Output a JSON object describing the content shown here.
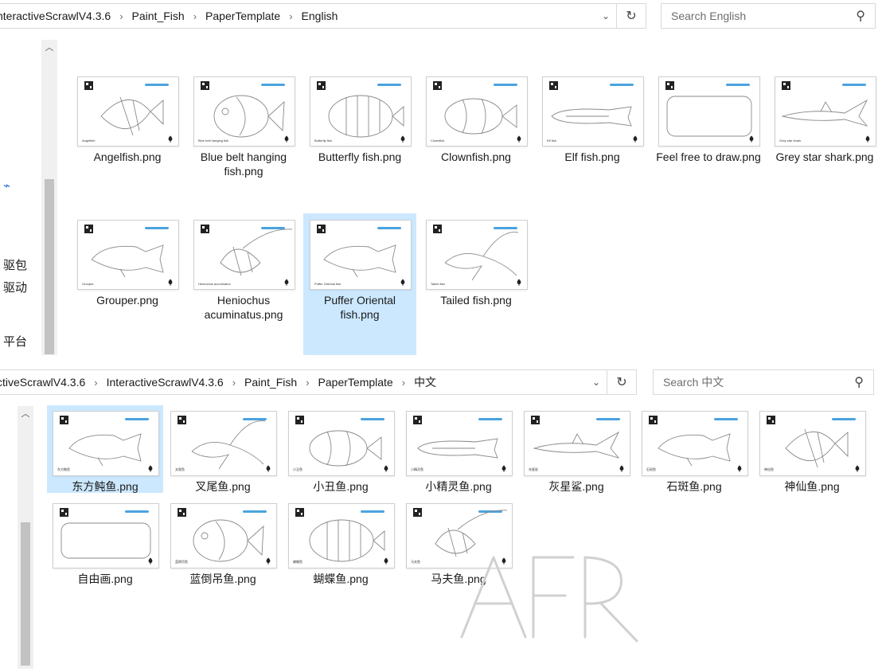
{
  "top_window": {
    "breadcrumb": [
      "nteractiveScrawlV4.3.6",
      "Paint_Fish",
      "PaperTemplate",
      "English"
    ],
    "search_placeholder": "Search English",
    "nav_labels": [
      "⌁",
      "驱包",
      "驱动",
      "平台"
    ],
    "files": [
      {
        "name": "Angelfish.png",
        "thumb_label": "Angelfish",
        "shape": "angel",
        "selected": false
      },
      {
        "name": "Blue belt hanging fish.png",
        "thumb_label": "Blue belt hanging fish",
        "shape": "round",
        "selected": false
      },
      {
        "name": "Butterfly fish.png",
        "thumb_label": "Butterfly fish",
        "shape": "butterfly",
        "selected": false
      },
      {
        "name": "Clownfish.png",
        "thumb_label": "Clownfish",
        "shape": "clown",
        "selected": false
      },
      {
        "name": "Elf fish.png",
        "thumb_label": "Elf fish",
        "shape": "elf",
        "selected": false
      },
      {
        "name": "Feel free to draw.png",
        "thumb_label": "",
        "shape": "frame",
        "selected": false
      },
      {
        "name": "Grey star shark.png",
        "thumb_label": "Grey star shark",
        "shape": "shark",
        "selected": false
      },
      {
        "name": "Grouper.png",
        "thumb_label": "Grouper",
        "shape": "grouper",
        "selected": false
      },
      {
        "name": "Heniochus acuminatus.png",
        "thumb_label": "Heniochus acuminatus",
        "shape": "heniochus",
        "selected": false
      },
      {
        "name": "Puffer Oriental fish.png",
        "thumb_label": "Puffer Oriental fish",
        "shape": "grouper",
        "selected": true
      },
      {
        "name": "Tailed fish.png",
        "thumb_label": "Tailed fish",
        "shape": "tailed",
        "selected": false
      }
    ]
  },
  "bottom_window": {
    "breadcrumb": [
      "ctiveScrawlV4.3.6",
      "InteractiveScrawlV4.3.6",
      "Paint_Fish",
      "PaperTemplate",
      "中文"
    ],
    "search_placeholder": "Search 中文",
    "files": [
      {
        "name": "东方鲀鱼.png",
        "thumb_label": "东方鲀鱼",
        "shape": "grouper",
        "selected": true
      },
      {
        "name": "叉尾鱼.png",
        "thumb_label": "叉尾鱼",
        "shape": "tailed",
        "selected": false
      },
      {
        "name": "小丑鱼.png",
        "thumb_label": "小丑鱼",
        "shape": "clown",
        "selected": false
      },
      {
        "name": "小精灵鱼.png",
        "thumb_label": "小精灵鱼",
        "shape": "elf",
        "selected": false
      },
      {
        "name": "灰星鲨.png",
        "thumb_label": "灰星鲨",
        "shape": "shark",
        "selected": false
      },
      {
        "name": "石斑鱼.png",
        "thumb_label": "石斑鱼",
        "shape": "grouper",
        "selected": false
      },
      {
        "name": "神仙鱼.png",
        "thumb_label": "神仙鱼",
        "shape": "angel",
        "selected": false
      },
      {
        "name": "自由画.png",
        "thumb_label": "",
        "shape": "frame",
        "selected": false
      },
      {
        "name": "蓝倒吊鱼.png",
        "thumb_label": "蓝倒吊鱼",
        "shape": "round",
        "selected": false
      },
      {
        "name": "蝴蝶鱼.png",
        "thumb_label": "蝴蝶鱼",
        "shape": "butterfly",
        "selected": false
      },
      {
        "name": "马夫鱼.png",
        "thumb_label": "马夫鱼",
        "shape": "heniochus",
        "selected": false
      }
    ]
  },
  "icons": {
    "dropdown": "chevron-down-icon",
    "refresh": "refresh-icon",
    "search": "search-icon",
    "scroll_up": "scroll-up-icon",
    "thumb_qr": "qr-code-icon",
    "thumb_logo": "brand-logo-icon",
    "thumb_spade": "spade-icon"
  },
  "colors": {
    "selection": "#cce8ff",
    "thumb_logo": "#4aa3df",
    "line_art": "#8a8a8a",
    "watermark": "#d0d0d0"
  }
}
